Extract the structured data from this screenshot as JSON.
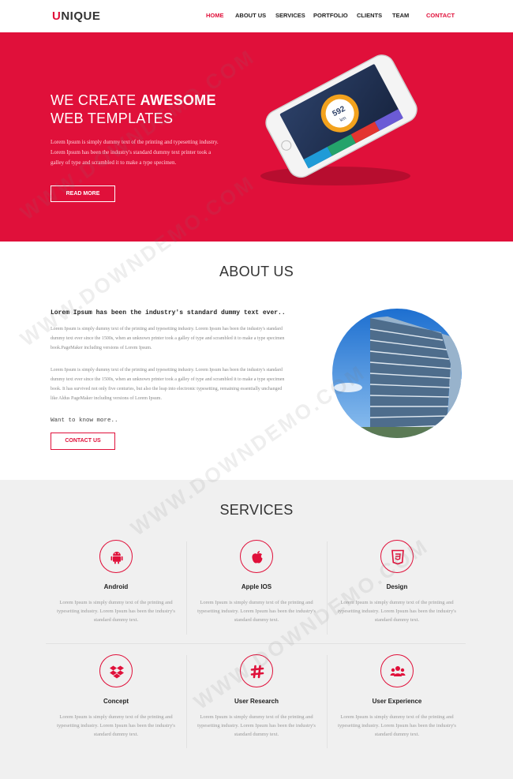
{
  "logo": {
    "text": "UNIQUE",
    "accent": "#e0103a"
  },
  "nav": {
    "items": [
      {
        "label": "HOME"
      },
      {
        "label": "ABOUT US"
      },
      {
        "label": "SERVICES"
      },
      {
        "label": "PORTFOLIO"
      },
      {
        "label": "CLIENTS"
      },
      {
        "label": "TEAM"
      },
      {
        "label": "CONTACT"
      }
    ]
  },
  "hero": {
    "title_line1_a": "WE CREATE ",
    "title_line1_b": "AWESOME",
    "title_line2": "WEB TEMPLATES",
    "text": "Lorem Ipsum is simply dummy text of the printing and typesetting industry. Lorem Ipsum has been the industry's standard dummy text printer took a galley of type and scrambled it to make a type specimen.",
    "button": "READ MORE",
    "background": "#e0103a",
    "phone_display": {
      "value": "592",
      "unit": "km"
    }
  },
  "about": {
    "title": "ABOUT US",
    "lead": "Lorem Ipsum has been the industry's standard dummy text ever..",
    "paragraph1": "Lorem Ipsum is simply dummy text of the printing and typesetting industry. Lorem Ipsum has been the industry's standard dummy text ever since the 1500s, when an unknown printer took a galley of type and scrambled it to make a type specimen book.PageMaker including versions of Lorem Ipsum.",
    "paragraph2": "Lorem Ipsum is simply dummy text of the printing and typesetting industry. Lorem Ipsum has been the industry's standard dummy text ever since the 1500s, when an unknown printer took a galley of type and scrambled it to make a type specimen book. It has survived not only five centuries, but also the leap into electronic typesetting, remaining essentially unchanged like Aldus PageMaker including versions of Lorem Ipsum.",
    "more": "Want to know more..",
    "button": "CONTACT US"
  },
  "services": {
    "title": "SERVICES",
    "items": [
      {
        "icon": "android-icon",
        "name": "Android",
        "desc": "Lorem Ipsum is simply dummy text of the printing and typesetting industry. Lorem Ipsum has been the industry's standard dummy text."
      },
      {
        "icon": "apple-icon",
        "name": "Apple IOS",
        "desc": "Lorem Ipsum is simply dummy text of the printing and typesetting industry. Lorem Ipsum has been the industry's standard dummy text."
      },
      {
        "icon": "html5-icon",
        "name": "Design",
        "desc": "Lorem Ipsum is simply dummy text of the printing and typesetting industry. Lorem Ipsum has been the industry's standard dummy text."
      },
      {
        "icon": "dropbox-icon",
        "name": "Concept",
        "desc": "Lorem Ipsum is simply dummy text of the printing and typesetting industry. Lorem Ipsum has been the industry's standard dummy text."
      },
      {
        "icon": "slack-icon",
        "name": "User Research",
        "desc": "Lorem Ipsum is simply dummy text of the printing and typesetting industry. Lorem Ipsum has been the industry's standard dummy text."
      },
      {
        "icon": "users-icon",
        "name": "User Experience",
        "desc": "Lorem Ipsum is simply dummy text of the printing and typesetting industry. Lorem Ipsum has been the industry's standard dummy text."
      }
    ]
  },
  "watermark": "WWW.DOWNDEMO.COM"
}
